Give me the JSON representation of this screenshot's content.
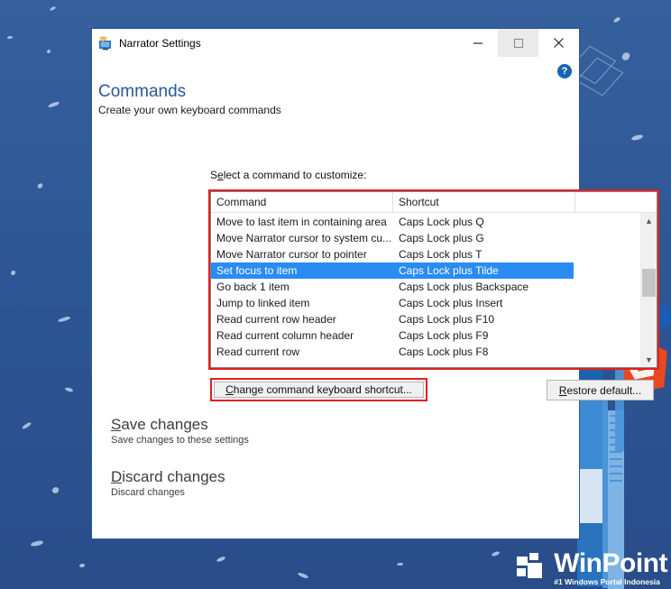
{
  "window": {
    "title": "Narrator Settings",
    "icon": "narrator-monitor-icon",
    "controls": {
      "minimize": "minimize-icon",
      "maximize": "maximize-icon",
      "close": "close-icon"
    },
    "help": "?"
  },
  "page": {
    "title": "Commands",
    "subtitle": "Create your own keyboard commands",
    "select_label_before": "S",
    "select_label_accel": "e",
    "select_label_after": "lect a command to customize:"
  },
  "list": {
    "columns": [
      "Command",
      "Shortcut",
      ""
    ],
    "rows": [
      {
        "command": "Move to last item in containing area",
        "shortcut": "Caps Lock plus Q",
        "selected": false
      },
      {
        "command": "Move Narrator cursor to system cu...",
        "shortcut": "Caps Lock plus G",
        "selected": false
      },
      {
        "command": "Move Narrator cursor to pointer",
        "shortcut": "Caps Lock plus T",
        "selected": false
      },
      {
        "command": "Set focus to item",
        "shortcut": "Caps Lock plus Tilde",
        "selected": true
      },
      {
        "command": "Go back 1 item",
        "shortcut": "Caps Lock plus Backspace",
        "selected": false
      },
      {
        "command": "Jump to linked item",
        "shortcut": "Caps Lock plus Insert",
        "selected": false
      },
      {
        "command": "Read current row header",
        "shortcut": "Caps Lock plus F10",
        "selected": false
      },
      {
        "command": "Read current column header",
        "shortcut": "Caps Lock plus F9",
        "selected": false
      },
      {
        "command": "Read current row",
        "shortcut": "Caps Lock plus F8",
        "selected": false
      }
    ],
    "scrollbar": {
      "up": "▲",
      "down": "▼"
    }
  },
  "buttons": {
    "change": {
      "accel": "C",
      "rest": "hange command keyboard shortcut..."
    },
    "restore": {
      "accel": "R",
      "rest": "estore default..."
    }
  },
  "links": [
    {
      "accel": "S",
      "title_rest": "ave changes",
      "subtitle": "Save changes to these settings"
    },
    {
      "accel": "D",
      "title_rest": "iscard changes",
      "subtitle": "Discard changes"
    }
  ],
  "watermark": {
    "title": "WinPoint",
    "subtitle": "#1 Windows Portal Indonesia",
    "logo": "winpoint-logo-icon"
  },
  "colors": {
    "desktop_blue": "#2d5493",
    "accent_title": "#2a5798",
    "selection_blue": "#2a8bf2",
    "annotation_red": "#e02020",
    "help_blue": "#1466b5",
    "pentagon_orange": "#e8491f"
  }
}
